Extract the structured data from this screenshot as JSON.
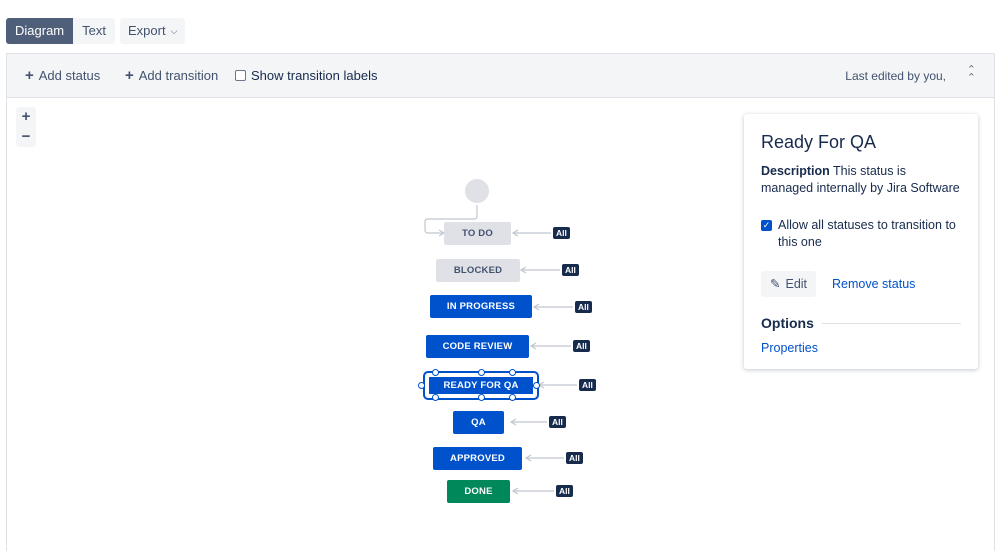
{
  "tabs": {
    "diagram": "Diagram",
    "text": "Text",
    "export": "Export"
  },
  "toolbar": {
    "add_status": "Add status",
    "add_transition": "Add transition",
    "show_labels": "Show transition labels",
    "last_edited": "Last edited by you,"
  },
  "zoom": {
    "in": "+",
    "out": "−"
  },
  "nodes": [
    {
      "label": "TO DO",
      "color": "#dfe1e6"
    },
    {
      "label": "BLOCKED",
      "color": "#dfe1e6"
    },
    {
      "label": "IN PROGRESS",
      "color": "#0052cc"
    },
    {
      "label": "CODE REVIEW",
      "color": "#0052cc"
    },
    {
      "label": "READY FOR QA",
      "color": "#0052cc"
    },
    {
      "label": "QA",
      "color": "#0052cc"
    },
    {
      "label": "APPROVED",
      "color": "#0052cc"
    },
    {
      "label": "DONE",
      "color": "#00875a"
    }
  ],
  "all_label": "All",
  "panel": {
    "title": "Ready For QA",
    "desc_label": "Description",
    "desc_text": "This status is managed internally by Jira Software",
    "allow_text": "Allow all statuses to transition to this one",
    "edit": "Edit",
    "remove": "Remove status",
    "options": "Options",
    "properties": "Properties"
  }
}
